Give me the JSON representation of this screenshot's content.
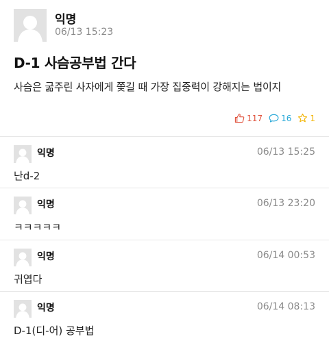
{
  "post": {
    "author": "익명",
    "time": "06/13 15:23",
    "title": "D-1 사슴공부법 간다",
    "body": "사슴은 굶주린 사자에게 쫓길 때 가장 집중력이 강해지는 법이지",
    "likes": "117",
    "comments": "16",
    "scraps": "1",
    "colors": {
      "like": "#e0523d",
      "comment": "#27a8d8",
      "scrap": "#f2b400"
    }
  },
  "comments": [
    {
      "author": "익명",
      "time": "06/13 15:25",
      "text": "난d-2"
    },
    {
      "author": "익명",
      "time": "06/13 23:20",
      "text": "ㅋㅋㅋㅋㅋ"
    },
    {
      "author": "익명",
      "time": "06/14 00:53",
      "text": "귀엽다"
    },
    {
      "author": "익명",
      "time": "06/14 08:13",
      "text": "D-1(디-어) 공부법"
    }
  ]
}
